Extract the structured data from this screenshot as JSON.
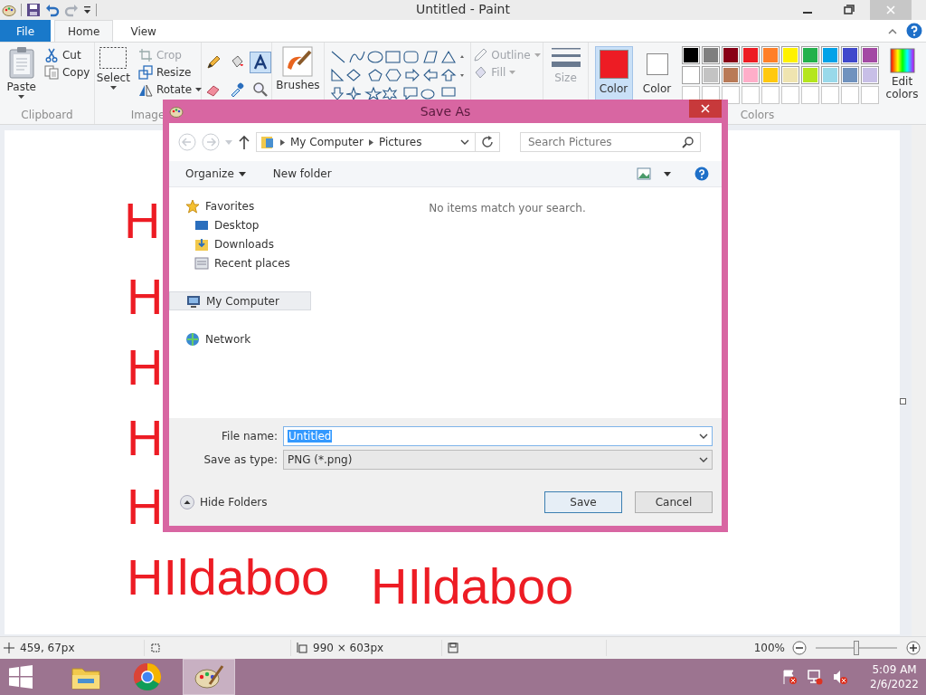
{
  "title_bar": {
    "title": "Untitled - Paint"
  },
  "ribbon_tabs": [
    {
      "label": "File",
      "kind": "file",
      "selected": false
    },
    {
      "label": "Home",
      "kind": "tab",
      "selected": true
    },
    {
      "label": "View",
      "kind": "tab",
      "selected": false
    }
  ],
  "clipboard": {
    "label": "Clipboard",
    "paste": "Paste",
    "cut": "Cut",
    "copy": "Copy"
  },
  "image": {
    "label": "Image",
    "select": "Select",
    "crop": "Crop",
    "resize": "Resize",
    "rotate": "Rotate",
    "crop_disabled": true
  },
  "tools": [
    {
      "kind": "pencil",
      "selected": false
    },
    {
      "kind": "fill",
      "selected": false
    },
    {
      "kind": "text",
      "selected": true
    },
    {
      "kind": "eraser",
      "selected": false
    },
    {
      "kind": "picker",
      "selected": false
    },
    {
      "kind": "magnifier",
      "selected": false
    }
  ],
  "brushes": {
    "label": "Brushes"
  },
  "shape_style": {
    "outline": "Outline",
    "fill": "Fill",
    "disabled": true
  },
  "size": {
    "label": "Size",
    "disabled": true
  },
  "colors": {
    "label": "Colors",
    "color_1": {
      "label": "Color",
      "color": "#ed1c24",
      "selected": true
    },
    "color_2": {
      "label": "Color",
      "color": "#ffffff",
      "selected": false
    },
    "palette": [
      {
        "color": "#000000"
      },
      {
        "color": "#7f7f7f"
      },
      {
        "color": "#880015"
      },
      {
        "color": "#ed1c24"
      },
      {
        "color": "#ff7f27"
      },
      {
        "color": "#fff200"
      },
      {
        "color": "#22b14c"
      },
      {
        "color": "#00a2e8"
      },
      {
        "color": "#3f48cc"
      },
      {
        "color": "#a349a4"
      },
      {
        "color": "#ffffff"
      },
      {
        "color": "#c3c3c3"
      },
      {
        "color": "#b97a57"
      },
      {
        "color": "#ffaec9"
      },
      {
        "color": "#ffc90e"
      },
      {
        "color": "#efe4b0"
      },
      {
        "color": "#b5e61d"
      },
      {
        "color": "#99d9ea"
      },
      {
        "color": "#7092be"
      },
      {
        "color": "#c8bfe7"
      }
    ],
    "edit_colors": "Edit colors"
  },
  "canvas": {
    "texts": [
      {
        "text": "H"
      },
      {
        "text": "H"
      },
      {
        "text": "H"
      },
      {
        "text": "H"
      },
      {
        "text": "H"
      },
      {
        "text": "HIldaboo"
      },
      {
        "text": "HIldaboo"
      }
    ]
  },
  "dialog": {
    "title": "Save As",
    "path": [
      "My Computer",
      "Pictures"
    ],
    "search_placeholder": "Search Pictures",
    "organize": "Organize",
    "new_folder": "New folder",
    "tree": [
      {
        "label": "Favorites",
        "kind": "favorites",
        "selected": false,
        "children": [
          {
            "label": "Desktop",
            "kind": "desktop",
            "selected": false
          },
          {
            "label": "Downloads",
            "kind": "downloads",
            "selected": false
          },
          {
            "label": "Recent places",
            "kind": "recent",
            "selected": false
          }
        ]
      },
      {
        "label": "My Computer",
        "kind": "computer",
        "selected": true
      },
      {
        "label": "Network",
        "kind": "network",
        "selected": false
      }
    ],
    "empty_message": "No items match your search.",
    "file_name": {
      "label": "File name:",
      "value": "Untitled"
    },
    "save_type": {
      "label": "Save as type:",
      "value": "PNG (*.png)"
    },
    "hide_folders": "Hide Folders",
    "buttons": [
      {
        "label": "Save",
        "default": true
      },
      {
        "label": "Cancel",
        "default": false
      }
    ]
  },
  "status_bar": {
    "cursor": "459, 67px",
    "size": "990 × 603px",
    "zoom": "100%",
    "zoom_slider": {
      "level": 0.5
    }
  },
  "taskbar": {
    "apps": [
      {
        "kind": "explorer",
        "selected": false
      },
      {
        "kind": "browser",
        "selected": false
      },
      {
        "kind": "paint",
        "selected": true
      }
    ],
    "time": "5:09 AM",
    "date": "2/6/2022"
  }
}
